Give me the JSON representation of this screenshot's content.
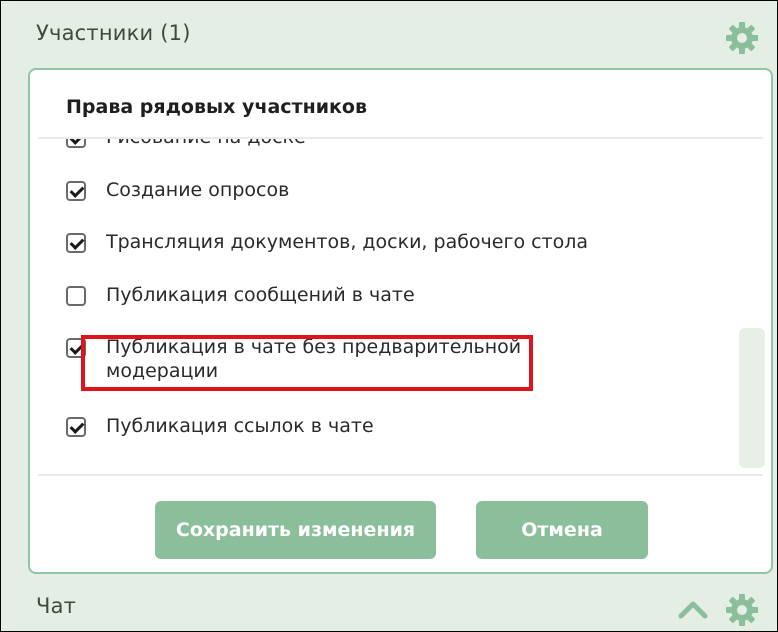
{
  "participants_section": {
    "title": "Участники (1)",
    "settings_icon": "gear-icon"
  },
  "rights_panel": {
    "title": "Права рядовых участников",
    "items": [
      {
        "label": "Рисование на доске",
        "checked": true,
        "partially_visible": true
      },
      {
        "label": "Создание опросов",
        "checked": true
      },
      {
        "label": "Трансляция документов, доски, рабочего стола",
        "checked": true
      },
      {
        "label": "Публикация сообщений в чате",
        "checked": false,
        "highlighted": true
      },
      {
        "label": "Публикация в чате без предварительной модерации",
        "checked": true
      },
      {
        "label": "Публикация ссылок в чате",
        "checked": true
      }
    ],
    "save_label": "Сохранить изменения",
    "cancel_label": "Отмена"
  },
  "chat_section": {
    "title": "Чат",
    "collapse_icon": "chevron-up-icon",
    "settings_icon": "gear-icon"
  },
  "colors": {
    "accent_green": "#8bbf9b",
    "panel_border": "#8fc7a4",
    "background": "#e5eee4",
    "highlight_red": "#e0131b"
  }
}
